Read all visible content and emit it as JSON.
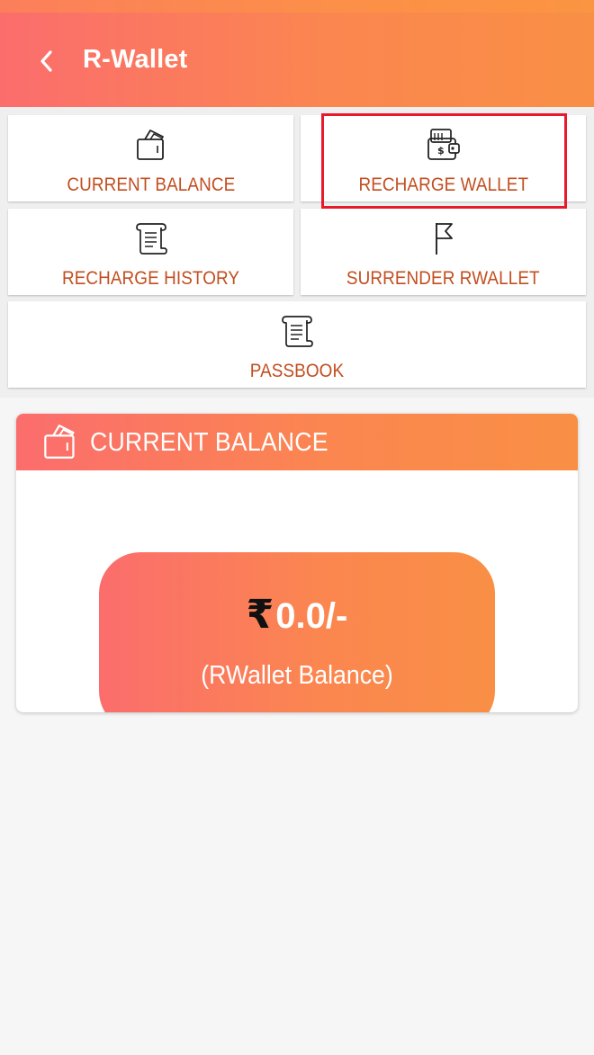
{
  "appbar": {
    "title": "R-Wallet",
    "back_icon": "chevron-left-icon"
  },
  "menu": {
    "tiles": [
      {
        "label": "CURRENT BALANCE",
        "icon": "wallet-card-icon"
      },
      {
        "label": "RECHARGE WALLET",
        "icon": "wallet-money-icon"
      },
      {
        "label": "RECHARGE HISTORY",
        "icon": "scroll-icon"
      },
      {
        "label": "SURRENDER RWALLET",
        "icon": "flag-icon"
      },
      {
        "label": "PASSBOOK",
        "icon": "scroll-icon"
      }
    ],
    "highlighted_tile": "RECHARGE WALLET"
  },
  "balance_card": {
    "title": "CURRENT BALANCE",
    "icon": "wallet-card-icon",
    "currency_symbol": "₹",
    "amount": "0.0/-",
    "caption": "(RWallet Balance)"
  },
  "colors": {
    "gradient_start": "#fb6d6d",
    "gradient_end": "#f98f45",
    "tile_label": "#c24e1f",
    "highlight": "#e8192c",
    "background": "#f6f6f6"
  }
}
